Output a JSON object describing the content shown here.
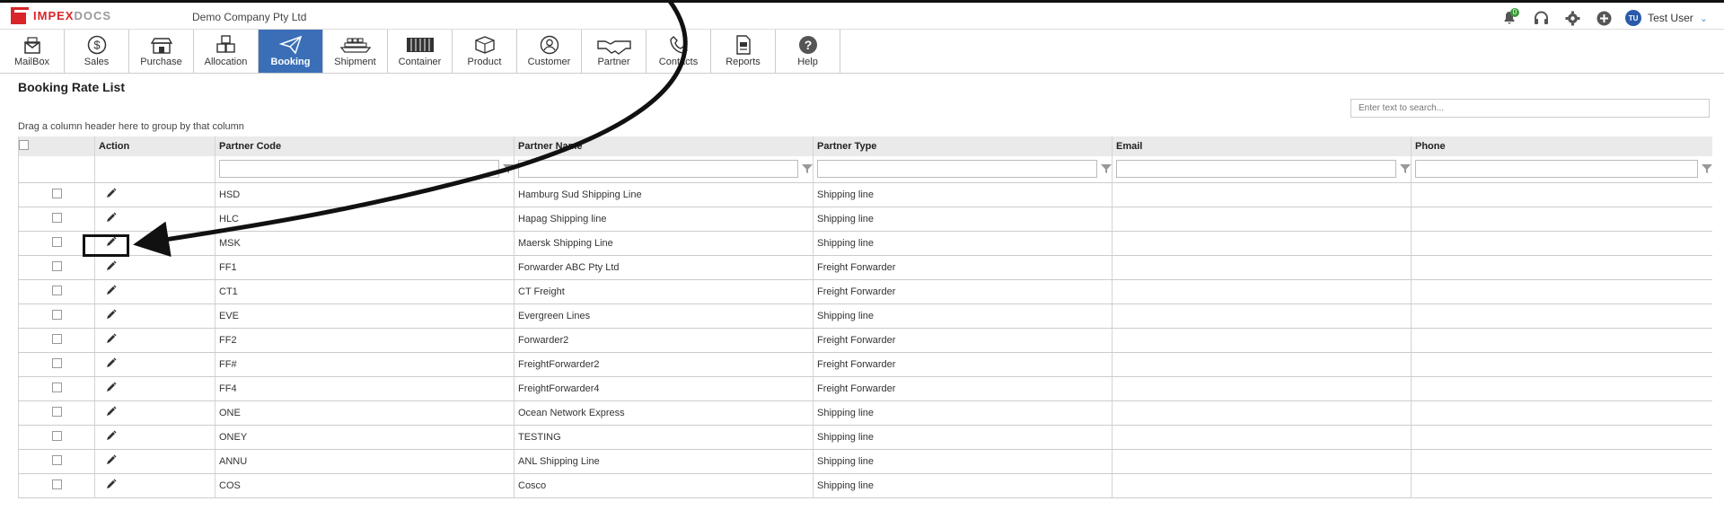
{
  "brand": {
    "part1": "IMPEX",
    "part2": "DOCS"
  },
  "company": "Demo Company Pty Ltd",
  "top_icons": [
    "bell-icon",
    "headset-icon",
    "gear-icon",
    "plus-circle-icon"
  ],
  "notification_count": "0",
  "user": {
    "initials": "TU",
    "name": "Test User"
  },
  "nav": [
    {
      "label": "MailBox",
      "icon": "mailbox-icon"
    },
    {
      "label": "Sales",
      "icon": "dollar-icon"
    },
    {
      "label": "Purchase",
      "icon": "store-icon"
    },
    {
      "label": "Allocation",
      "icon": "boxes-icon"
    },
    {
      "label": "Booking",
      "icon": "paper-plane-icon",
      "active": true
    },
    {
      "label": "Shipment",
      "icon": "ship-icon"
    },
    {
      "label": "Container",
      "icon": "container-icon"
    },
    {
      "label": "Product",
      "icon": "box-icon"
    },
    {
      "label": "Customer",
      "icon": "user-icon"
    },
    {
      "label": "Partner",
      "icon": "handshake-icon"
    },
    {
      "label": "Contacts",
      "icon": "phone-icon"
    },
    {
      "label": "Reports",
      "icon": "report-icon"
    },
    {
      "label": "Help",
      "icon": "help-icon"
    }
  ],
  "page_title": "Booking Rate List",
  "search_placeholder": "Enter text to search...",
  "group_hint": "Drag a column header here to group by that column",
  "columns": [
    "Action",
    "Partner Code",
    "Partner Name",
    "Partner Type",
    "Email",
    "Phone"
  ],
  "rows": [
    {
      "code": "HSD",
      "name": "Hamburg Sud Shipping Line",
      "type": "Shipping line",
      "email": "",
      "phone": ""
    },
    {
      "code": "HLC",
      "name": "Hapag Shipping line",
      "type": "Shipping line",
      "email": "",
      "phone": ""
    },
    {
      "code": "MSK",
      "name": "Maersk Shipping Line",
      "type": "Shipping line",
      "email": "",
      "phone": ""
    },
    {
      "code": "FF1",
      "name": "Forwarder ABC Pty Ltd",
      "type": "Freight Forwarder",
      "email": "",
      "phone": ""
    },
    {
      "code": "CT1",
      "name": "CT Freight",
      "type": "Freight Forwarder",
      "email": "",
      "phone": ""
    },
    {
      "code": "EVE",
      "name": "Evergreen Lines",
      "type": "Shipping line",
      "email": "",
      "phone": ""
    },
    {
      "code": "FF2",
      "name": "Forwarder2",
      "type": "Freight Forwarder",
      "email": "",
      "phone": ""
    },
    {
      "code": "FF#",
      "name": "FreightForwarder2",
      "type": "Freight Forwarder",
      "email": "",
      "phone": ""
    },
    {
      "code": "FF4",
      "name": "FreightForwarder4",
      "type": "Freight Forwarder",
      "email": "",
      "phone": ""
    },
    {
      "code": "ONE",
      "name": "Ocean Network Express",
      "type": "Shipping line",
      "email": "",
      "phone": ""
    },
    {
      "code": "ONEY",
      "name": "TESTING",
      "type": "Shipping line",
      "email": "",
      "phone": ""
    },
    {
      "code": "ANNU",
      "name": "ANL Shipping Line",
      "type": "Shipping line",
      "email": "",
      "phone": ""
    },
    {
      "code": "COS",
      "name": "Cosco",
      "type": "Shipping line",
      "email": "",
      "phone": ""
    }
  ],
  "colors": {
    "accent": "#3a6fb8",
    "brand_red": "#d9252a"
  }
}
